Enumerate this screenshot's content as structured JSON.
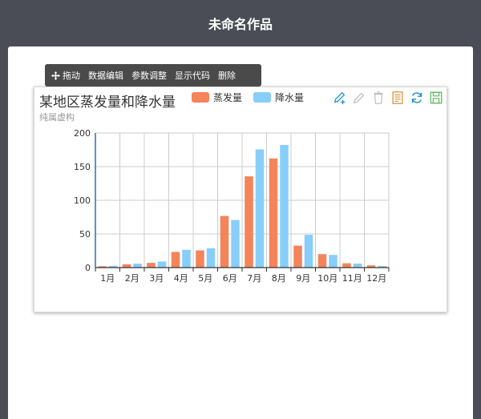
{
  "app": {
    "title": "未命名作品"
  },
  "toolbar": {
    "drag": "拖动",
    "edit_data": "数据编辑",
    "params": "参数调整",
    "show_code": "显示代码",
    "delete": "删除"
  },
  "chart_tools": [
    "pencil-add-icon",
    "pencil-icon",
    "trash-icon",
    "data-view-icon",
    "refresh-icon",
    "save-icon"
  ],
  "colors": {
    "evaporation": "#f4845a",
    "precipitation": "#87cefa",
    "axis": "#2f6fa7",
    "grid": "#cccccc"
  },
  "chart_data": {
    "type": "bar",
    "title": "某地区蒸发量和降水量",
    "subtitle": "纯属虚构",
    "categories": [
      "1月",
      "2月",
      "3月",
      "4月",
      "5月",
      "6月",
      "7月",
      "8月",
      "9月",
      "10月",
      "11月",
      "12月"
    ],
    "series": [
      {
        "name": "蒸发量",
        "values": [
          2.0,
          4.9,
          7.0,
          23.2,
          25.6,
          76.7,
          135.6,
          162.2,
          32.6,
          20.0,
          6.4,
          3.3
        ]
      },
      {
        "name": "降水量",
        "values": [
          2.6,
          5.9,
          9.0,
          26.4,
          28.7,
          70.7,
          175.6,
          182.2,
          48.7,
          18.8,
          6.0,
          2.3
        ]
      }
    ],
    "yticks": [
      0,
      50,
      100,
      150,
      200
    ],
    "ylim": [
      0,
      200
    ],
    "grid": true,
    "legend": "top"
  }
}
